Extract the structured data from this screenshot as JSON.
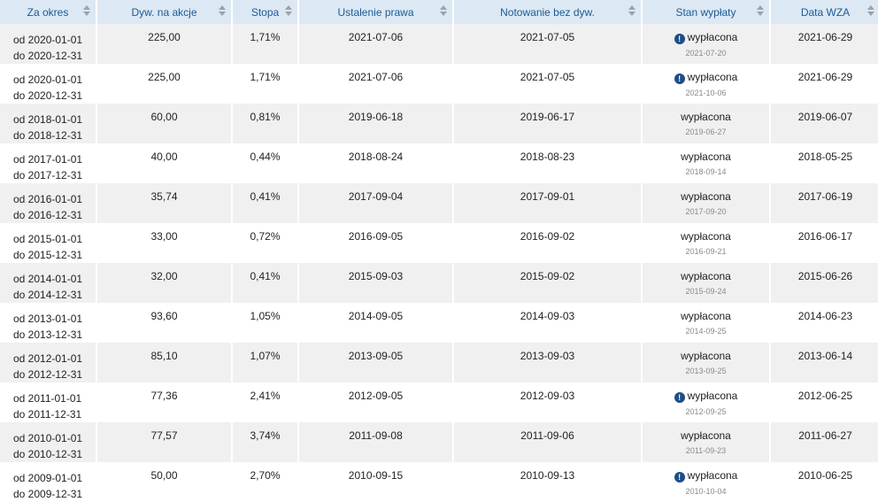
{
  "columns": [
    "Za okres",
    "Dyw. na akcje",
    "Stopa",
    "Ustalenie prawa",
    "Notowanie bez dyw.",
    "Stan wypłaty",
    "Data WZA"
  ],
  "rows": [
    {
      "period_from": "od 2020-01-01",
      "period_to": "do 2020-12-31",
      "dividend": "225,00",
      "yield": "1,71%",
      "record_date": "2021-07-06",
      "ex_date": "2021-07-05",
      "status": "wypłacona",
      "pay_date": "2021-07-20",
      "info": true,
      "agm_date": "2021-06-29"
    },
    {
      "period_from": "od 2020-01-01",
      "period_to": "do 2020-12-31",
      "dividend": "225,00",
      "yield": "1,71%",
      "record_date": "2021-07-06",
      "ex_date": "2021-07-05",
      "status": "wypłacona",
      "pay_date": "2021-10-06",
      "info": true,
      "agm_date": "2021-06-29"
    },
    {
      "period_from": "od 2018-01-01",
      "period_to": "do 2018-12-31",
      "dividend": "60,00",
      "yield": "0,81%",
      "record_date": "2019-06-18",
      "ex_date": "2019-06-17",
      "status": "wypłacona",
      "pay_date": "2019-06-27",
      "info": false,
      "agm_date": "2019-06-07"
    },
    {
      "period_from": "od 2017-01-01",
      "period_to": "do 2017-12-31",
      "dividend": "40,00",
      "yield": "0,44%",
      "record_date": "2018-08-24",
      "ex_date": "2018-08-23",
      "status": "wypłacona",
      "pay_date": "2018-09-14",
      "info": false,
      "agm_date": "2018-05-25"
    },
    {
      "period_from": "od 2016-01-01",
      "period_to": "do 2016-12-31",
      "dividend": "35,74",
      "yield": "0,41%",
      "record_date": "2017-09-04",
      "ex_date": "2017-09-01",
      "status": "wypłacona",
      "pay_date": "2017-09-20",
      "info": false,
      "agm_date": "2017-06-19"
    },
    {
      "period_from": "od 2015-01-01",
      "period_to": "do 2015-12-31",
      "dividend": "33,00",
      "yield": "0,72%",
      "record_date": "2016-09-05",
      "ex_date": "2016-09-02",
      "status": "wypłacona",
      "pay_date": "2016-09-21",
      "info": false,
      "agm_date": "2016-06-17"
    },
    {
      "period_from": "od 2014-01-01",
      "period_to": "do 2014-12-31",
      "dividend": "32,00",
      "yield": "0,41%",
      "record_date": "2015-09-03",
      "ex_date": "2015-09-02",
      "status": "wypłacona",
      "pay_date": "2015-09-24",
      "info": false,
      "agm_date": "2015-06-26"
    },
    {
      "period_from": "od 2013-01-01",
      "period_to": "do 2013-12-31",
      "dividend": "93,60",
      "yield": "1,05%",
      "record_date": "2014-09-05",
      "ex_date": "2014-09-03",
      "status": "wypłacona",
      "pay_date": "2014-09-25",
      "info": false,
      "agm_date": "2014-06-23"
    },
    {
      "period_from": "od 2012-01-01",
      "period_to": "do 2012-12-31",
      "dividend": "85,10",
      "yield": "1,07%",
      "record_date": "2013-09-05",
      "ex_date": "2013-09-03",
      "status": "wypłacona",
      "pay_date": "2013-09-25",
      "info": false,
      "agm_date": "2013-06-14"
    },
    {
      "period_from": "od 2011-01-01",
      "period_to": "do 2011-12-31",
      "dividend": "77,36",
      "yield": "2,41%",
      "record_date": "2012-09-05",
      "ex_date": "2012-09-03",
      "status": "wypłacona",
      "pay_date": "2012-09-25",
      "info": true,
      "agm_date": "2012-06-25"
    },
    {
      "period_from": "od 2010-01-01",
      "period_to": "do 2010-12-31",
      "dividend": "77,57",
      "yield": "3,74%",
      "record_date": "2011-09-08",
      "ex_date": "2011-09-06",
      "status": "wypłacona",
      "pay_date": "2011-09-23",
      "info": false,
      "agm_date": "2011-06-27"
    },
    {
      "period_from": "od 2009-01-01",
      "period_to": "do 2009-12-31",
      "dividend": "50,00",
      "yield": "2,70%",
      "record_date": "2010-09-15",
      "ex_date": "2010-09-13",
      "status": "wypłacona",
      "pay_date": "2010-10-04",
      "info": true,
      "agm_date": "2010-06-25"
    }
  ],
  "icons": {
    "info": "info-icon",
    "info_glyph": "!",
    "sort": "sort-icon"
  },
  "colors": {
    "header_bg": "#dce8f3",
    "header_text": "#1a5b96",
    "row_alt": "#f0f0f0",
    "info_icon": "#1d4d86"
  }
}
